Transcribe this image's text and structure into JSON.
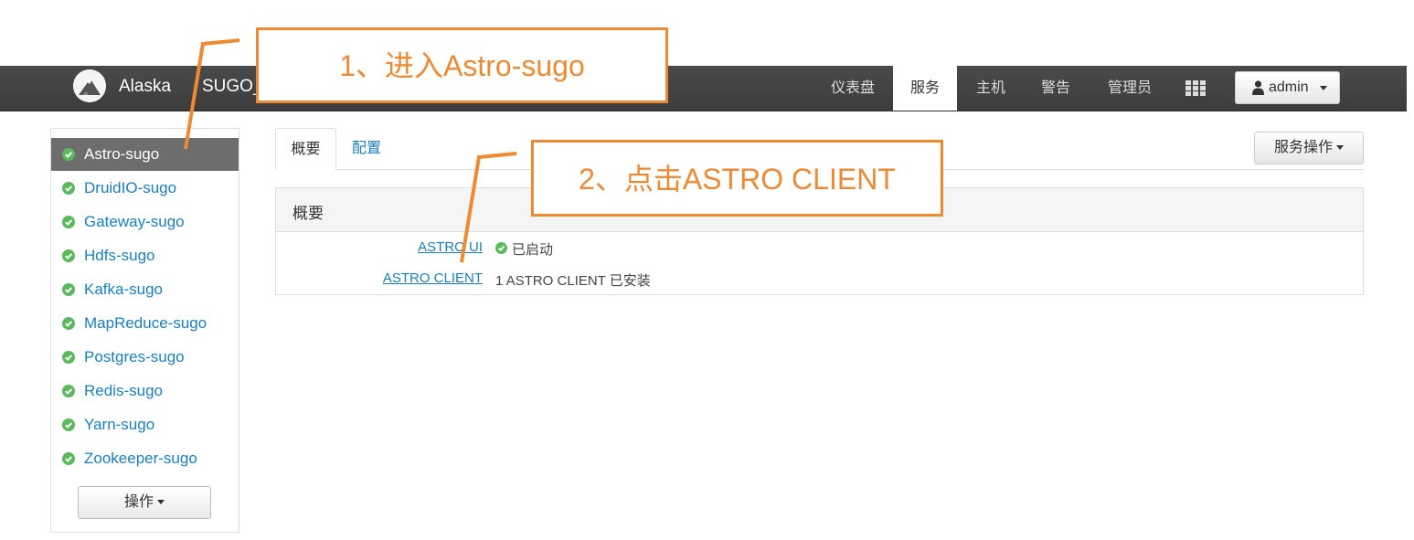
{
  "navbar": {
    "brand": "Alaska",
    "cluster": "SUGO_",
    "items": [
      {
        "label": "仪表盘",
        "active": false
      },
      {
        "label": "服务",
        "active": true
      },
      {
        "label": "主机",
        "active": false
      },
      {
        "label": "警告",
        "active": false
      },
      {
        "label": "管理员",
        "active": false
      }
    ],
    "apps_icon": "grid-icon",
    "user": {
      "icon": "user-icon",
      "label": "admin"
    }
  },
  "sidebar": {
    "services": [
      {
        "label": "Astro-sugo",
        "status": "ok",
        "active": true
      },
      {
        "label": "DruidIO-sugo",
        "status": "ok"
      },
      {
        "label": "Gateway-sugo",
        "status": "ok"
      },
      {
        "label": "Hdfs-sugo",
        "status": "ok"
      },
      {
        "label": "Kafka-sugo",
        "status": "ok"
      },
      {
        "label": "MapReduce-sugo",
        "status": "ok"
      },
      {
        "label": "Postgres-sugo",
        "status": "ok"
      },
      {
        "label": "Redis-sugo",
        "status": "ok"
      },
      {
        "label": "Yarn-sugo",
        "status": "ok"
      },
      {
        "label": "Zookeeper-sugo",
        "status": "ok"
      }
    ],
    "actions_label": "操作"
  },
  "main": {
    "tabs": [
      {
        "label": "概要",
        "active": true
      },
      {
        "label": "配置",
        "active": false
      }
    ],
    "service_actions_label": "服务操作",
    "summary": {
      "title": "概要",
      "components": [
        {
          "name": "ASTRO UI",
          "status_icon": "check-circle-icon",
          "status": "已启动"
        },
        {
          "name": "ASTRO CLIENT",
          "status": "1 ASTRO CLIENT 已安装"
        }
      ]
    }
  },
  "annotations": {
    "step1": "1、进入Astro-sugo",
    "step2": "2、点击ASTRO CLIENT"
  },
  "colors": {
    "navbar": "#3f3f3f",
    "link": "#1a7fc1",
    "status_ok": "#5cb85c",
    "annotation": "#ee8a34"
  }
}
